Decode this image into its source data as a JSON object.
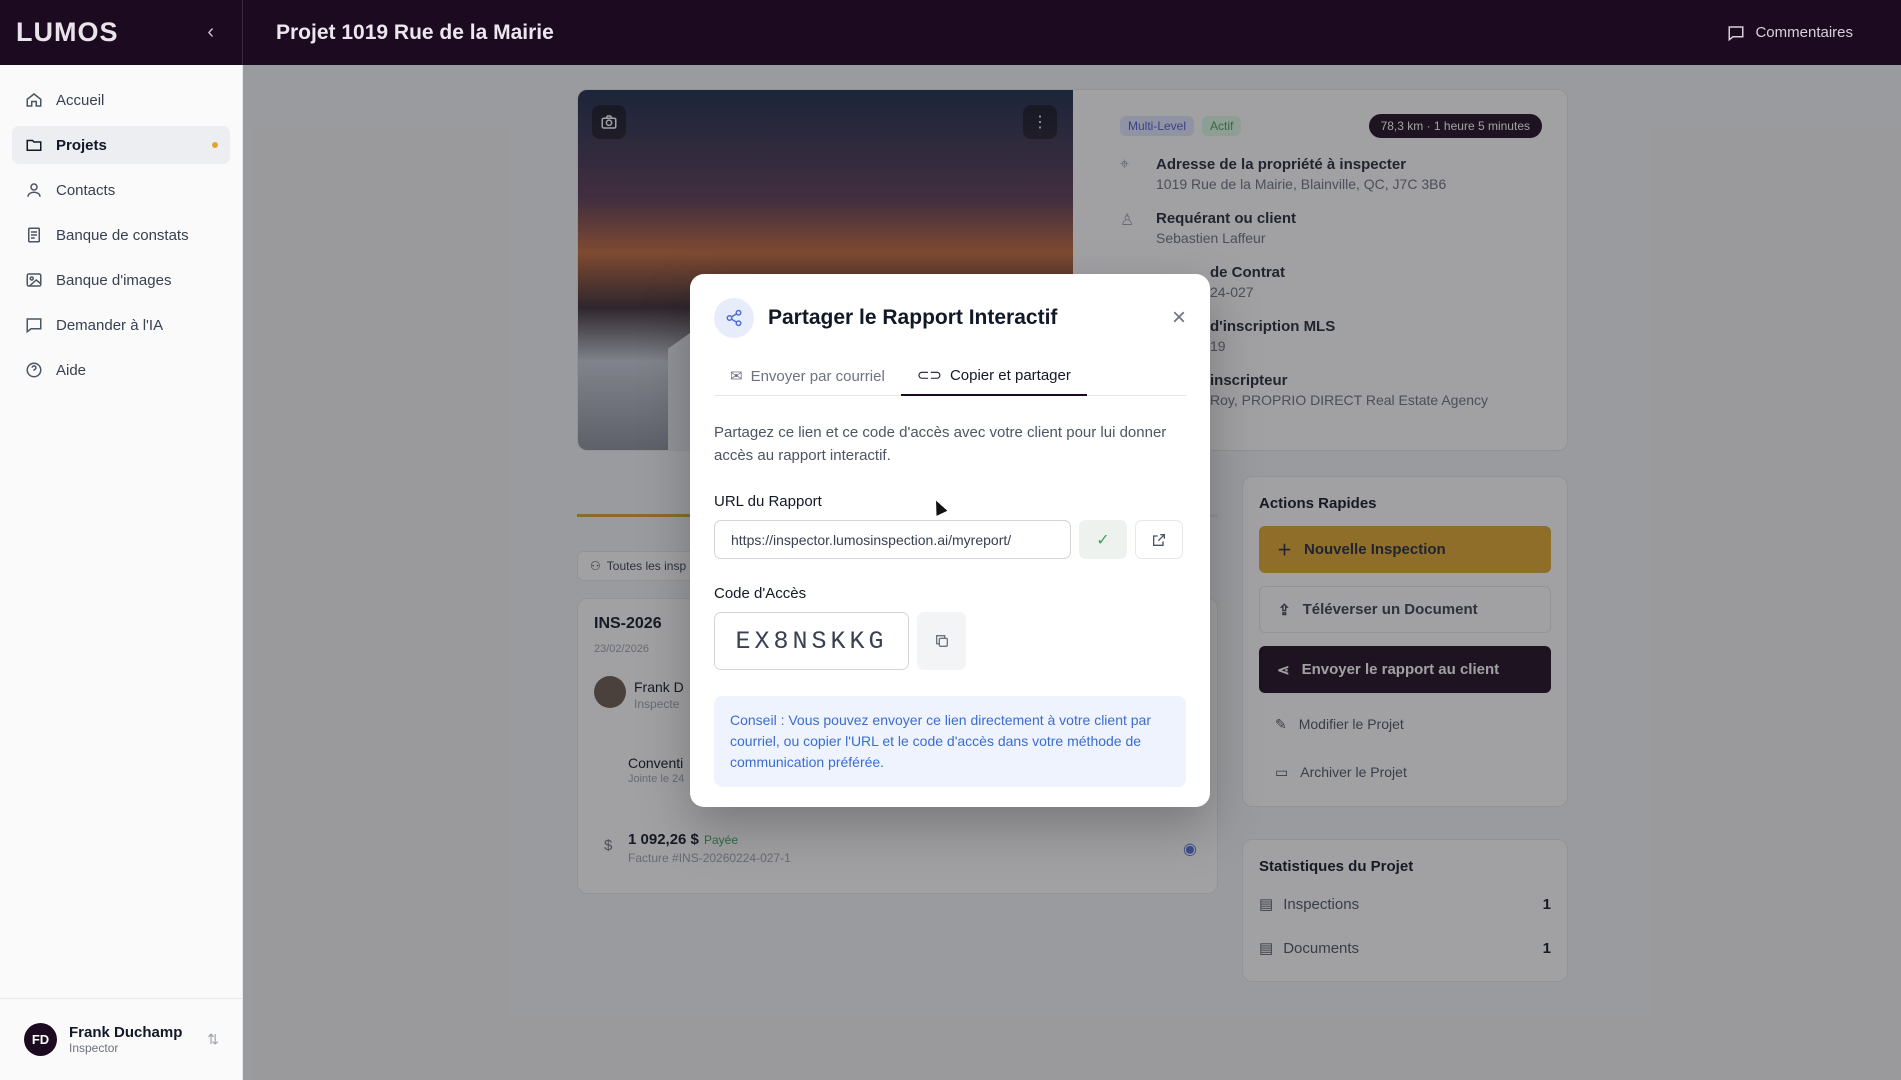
{
  "app": {
    "logo": "LUMOS",
    "page_title": "Projet 1019 Rue de la Mairie",
    "comments_label": "Commentaires"
  },
  "sidebar": {
    "items": [
      {
        "label": "Accueil",
        "icon": "home-icon"
      },
      {
        "label": "Projets",
        "icon": "folder-icon"
      },
      {
        "label": "Contacts",
        "icon": "user-icon"
      },
      {
        "label": "Banque de constats",
        "icon": "book-icon"
      },
      {
        "label": "Banque d'images",
        "icon": "image-icon"
      },
      {
        "label": "Demander à l'IA",
        "icon": "chat-icon"
      },
      {
        "label": "Aide",
        "icon": "help-icon"
      }
    ],
    "user": {
      "initials": "FD",
      "name": "Frank Duchamp",
      "role": "Inspector"
    }
  },
  "project": {
    "badges": [
      "Multi-Level",
      "Actif"
    ],
    "distance": "78,3 km · 1 heure 5 minutes",
    "address_label": "Adresse de la propriété à inspecter",
    "address_value": "1019 Rue de la Mairie, Blainville, QC, J7C 3B6",
    "client_label": "Requérant ou client",
    "client_value": "Sebastien Laffeur",
    "contract_label": "de Contrat",
    "contract_value": "24-027",
    "mls_label": "d'inscription MLS",
    "mls_value": "19",
    "broker_label": "inscripteur",
    "broker_value": "Roy, PROPRIO DIRECT Real Estate Agency"
  },
  "inspections": {
    "filter": "Toutes les insp",
    "code": "INS-2026",
    "date": "23/02/2026",
    "inspector": "Frank D",
    "role": "Inspecte",
    "doc_title": "Conventi",
    "doc_sub": "Jointe le 24",
    "amount": "1 092,26 $",
    "paid": "Payée",
    "invoice": "Facture #INS-20260224-027-1"
  },
  "actions": {
    "title": "Actions Rapides",
    "new_inspection": "Nouvelle Inspection",
    "upload": "Téléverser un Document",
    "send_report": "Envoyer le rapport au client",
    "edit": "Modifier le Projet",
    "archive": "Archiver le Projet"
  },
  "stats": {
    "title": "Statistiques du Projet",
    "rows": [
      {
        "label": "Inspections",
        "value": "1"
      },
      {
        "label": "Documents",
        "value": "1"
      }
    ]
  },
  "modal": {
    "title": "Partager le Rapport Interactif",
    "tab_email": "Envoyer par courriel",
    "tab_copy": "Copier et partager",
    "description": "Partagez ce lien et ce code d'accès avec votre client pour lui donner accès au rapport interactif.",
    "url_label": "URL du Rapport",
    "url_value": "https://inspector.lumosinspection.ai/myreport/",
    "code_label": "Code d'Accès",
    "code_value": "EX8NSKKG",
    "tip": "Conseil : Vous pouvez envoyer ce lien directement à votre client par courriel, ou copier l'URL et le code d'accès dans votre méthode de communication préférée."
  },
  "colors": {
    "brand_dark": "#1c0b20",
    "accent": "#e0a72f",
    "info_blue": "#3b6ccf"
  }
}
